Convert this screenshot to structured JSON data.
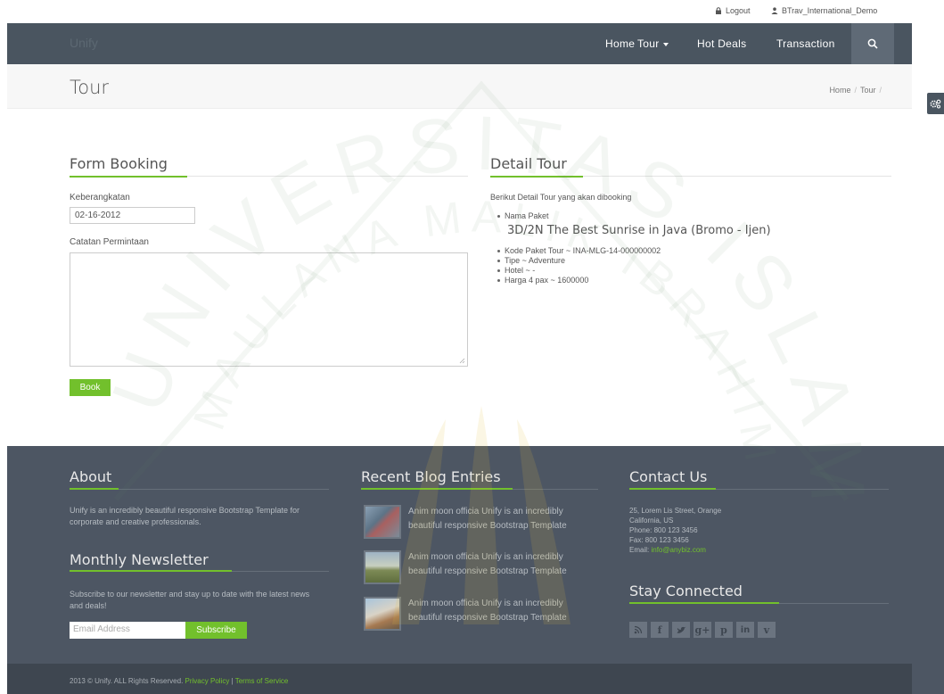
{
  "topbar": {
    "logout": "Logout",
    "user": "BTrav_International_Demo"
  },
  "nav": {
    "logo": "Unify",
    "items": [
      "Home",
      "Tour",
      "Hot Deals",
      "Transaction"
    ]
  },
  "band": {
    "title": "Tour",
    "crumbs": [
      "Home",
      "Tour"
    ]
  },
  "form": {
    "heading": "Form Booking",
    "departure_label": "Keberangkatan",
    "departure_value": "02-16-2012",
    "notes_label": "Catatan Permintaan",
    "book_label": "Book"
  },
  "detail": {
    "heading": "Detail Tour",
    "intro": "Berikut Detail Tour yang akan dibooking",
    "package_label": "Nama Paket",
    "package_name": "3D/2N The Best Sunrise in Java (Bromo - Ijen)",
    "items": [
      "Kode Paket Tour ~ INA-MLG-14-000000002",
      "Tipe ~ Adventure",
      "Hotel ~ -",
      "Harga 4 pax ~ 1600000"
    ]
  },
  "footer": {
    "about_heading": "About",
    "about_text": "Unify is an incredibly beautiful responsive Bootstrap Template for corporate and creative professionals.",
    "newsletter_heading": "Monthly Newsletter",
    "newsletter_text": "Subscribe to our newsletter and stay up to date with the latest news and deals!",
    "email_placeholder": "Email Address",
    "subscribe_label": "Subscribe",
    "blog_heading": "Recent Blog Entries",
    "blog_entries": [
      "Anim moon officia Unify is an incredibly beautiful responsive Bootstrap Template",
      "Anim moon officia Unify is an incredibly beautiful responsive Bootstrap Template",
      "Anim moon officia Unify is an incredibly beautiful responsive Bootstrap Template"
    ],
    "contact_heading": "Contact Us",
    "contact_lines": [
      "25, Lorem Lis Street, Orange",
      "California, US",
      "Phone: 800 123 3456",
      "Fax: 800 123 3456"
    ],
    "email_label": "Email:",
    "email_value": "info@anybiz.com",
    "stay_heading": "Stay Connected",
    "social_icons": [
      "rss-icon",
      "facebook-icon",
      "twitter-icon",
      "google-plus-icon",
      "pinterest-icon",
      "linkedin-icon",
      "vimeo-icon"
    ]
  },
  "copyright": {
    "text": "2013 © Unify. ALL Rights Reserved.",
    "privacy": "Privacy Policy",
    "separator": "|",
    "terms": "Terms of Service"
  },
  "colors": {
    "accent": "#72c02c",
    "nav": "#4a5560",
    "footer": "#4d5663"
  }
}
